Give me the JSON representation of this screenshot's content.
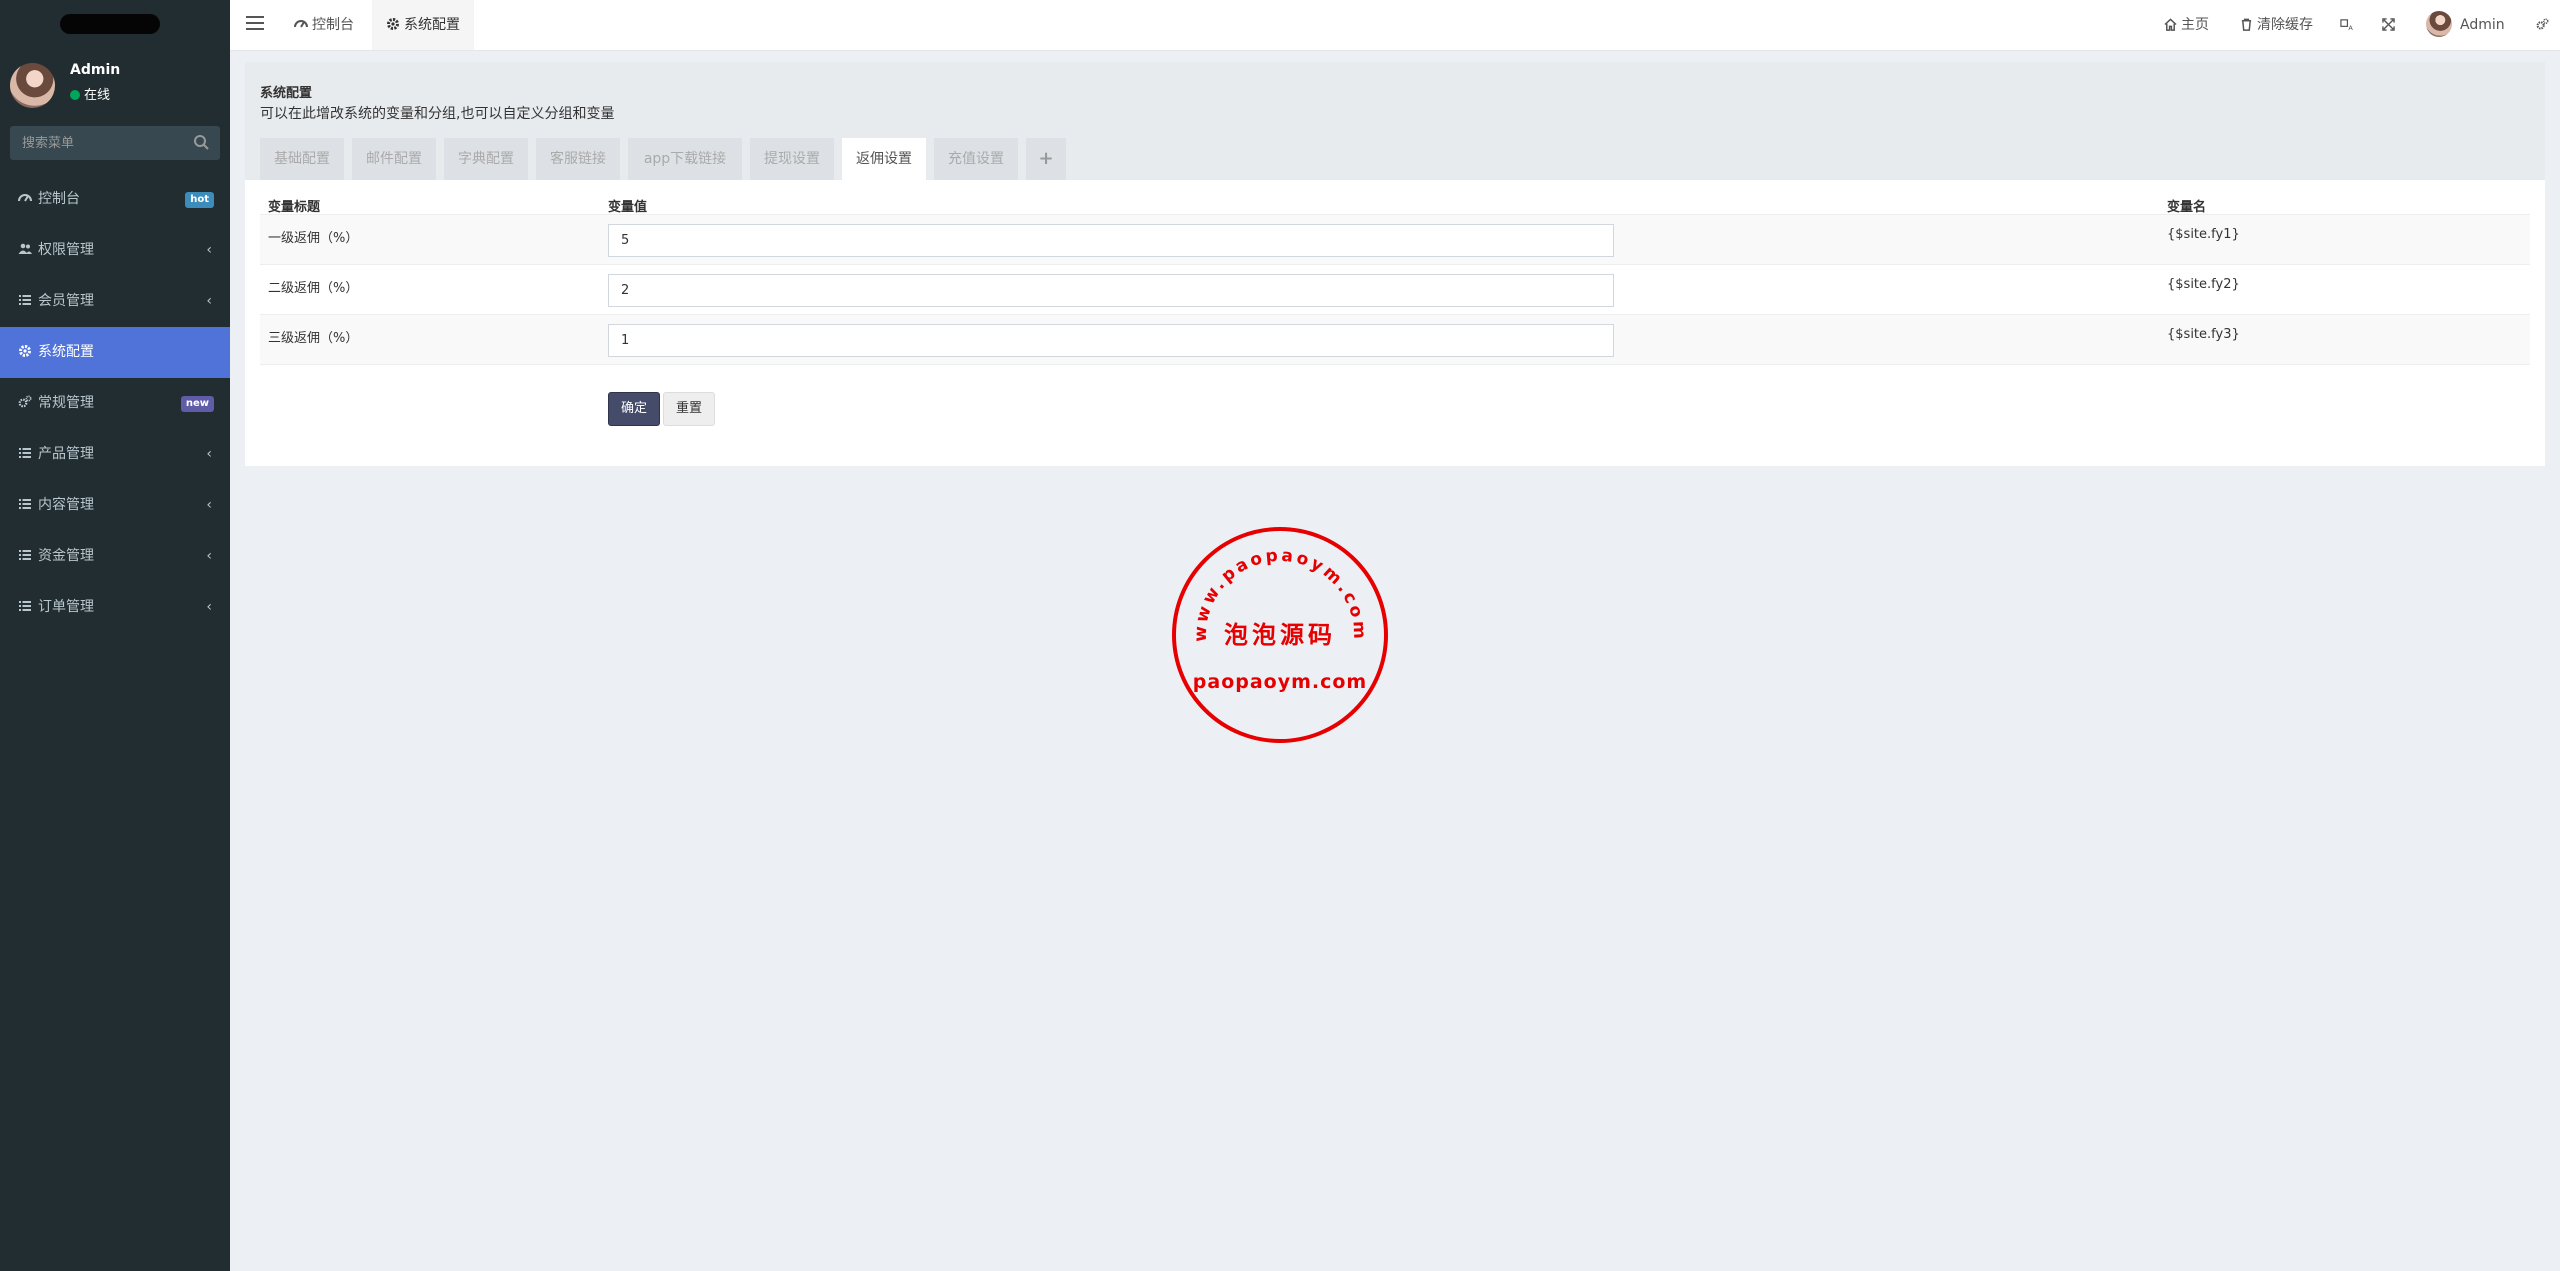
{
  "sidebar": {
    "user": {
      "name": "Admin",
      "status": "在线"
    },
    "search_placeholder": "搜索菜单",
    "menu": [
      {
        "label": "控制台",
        "icon": "dashboard-icon",
        "badge": "hot",
        "badge_color": "#3c8dbc"
      },
      {
        "label": "权限管理",
        "icon": "users-icon",
        "caret": "‹"
      },
      {
        "label": "会员管理",
        "icon": "list-icon",
        "caret": "‹"
      },
      {
        "label": "系统配置",
        "icon": "gear-icon",
        "active": true
      },
      {
        "label": "常规管理",
        "icon": "cogs-icon",
        "badge": "new",
        "badge_color": "#605ca8"
      },
      {
        "label": "产品管理",
        "icon": "list-icon",
        "caret": "‹"
      },
      {
        "label": "内容管理",
        "icon": "list-icon",
        "caret": "‹"
      },
      {
        "label": "资金管理",
        "icon": "list-icon",
        "caret": "‹"
      },
      {
        "label": "订单管理",
        "icon": "list-icon",
        "caret": "‹"
      }
    ]
  },
  "header": {
    "tabs": [
      {
        "label": "控制台",
        "icon": "dashboard-icon"
      },
      {
        "label": "系统配置",
        "icon": "gear-icon",
        "active": true
      }
    ],
    "home_label": "主页",
    "clear_cache_label": "清除缓存",
    "admin_label": "Admin"
  },
  "config": {
    "title": "系统配置",
    "description": "可以在此增改系统的变量和分组,也可以自定义分组和变量",
    "tabs": [
      "基础配置",
      "邮件配置",
      "字典配置",
      "客服链接",
      "app下载链接",
      "提现设置",
      "返佣设置",
      "充值设置",
      "+"
    ],
    "active_tab": "返佣设置",
    "columns": {
      "title": "变量标题",
      "value": "变量值",
      "name": "变量名"
    },
    "rows": [
      {
        "title": "一级返佣（%）",
        "value": "5",
        "name": "{$site.fy1}"
      },
      {
        "title": "二级返佣（%）",
        "value": "2",
        "name": "{$site.fy2}"
      },
      {
        "title": "三级返佣（%）",
        "value": "1",
        "name": "{$site.fy3}"
      }
    ],
    "submit_label": "确定",
    "reset_label": "重置"
  },
  "stamp": {
    "arc_text": "www.paopaoym.com",
    "main_text": "泡泡源码",
    "bottom_text": "paopaoym.com",
    "color": "#e60000"
  }
}
